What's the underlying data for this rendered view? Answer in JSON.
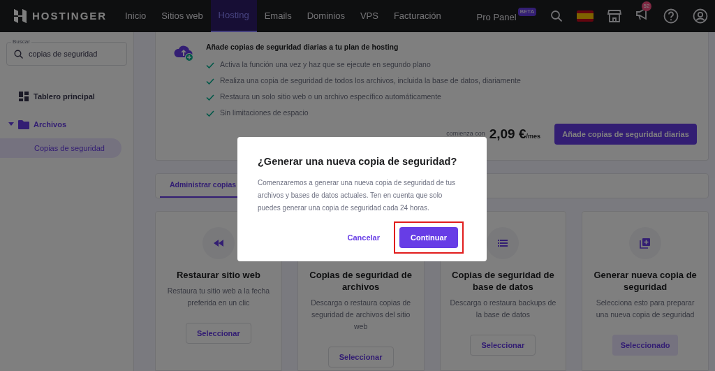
{
  "topbar": {
    "logo": "HOSTINGER",
    "nav": [
      {
        "label": "Inicio",
        "selected": false
      },
      {
        "label": "Sitios web",
        "selected": false
      },
      {
        "label": "Hosting",
        "selected": true
      },
      {
        "label": "Emails",
        "selected": false
      },
      {
        "label": "Dominios",
        "selected": false
      },
      {
        "label": "VPS",
        "selected": false
      },
      {
        "label": "Facturación",
        "selected": false
      }
    ],
    "pro_panel": "Pro Panel",
    "beta_badge": "BETA",
    "notification_count": "52"
  },
  "sidebar": {
    "search": {
      "label": "Buscar",
      "value": "copias de seguridad"
    },
    "items": [
      {
        "label": "Tablero principal",
        "kind": "dashboard",
        "selected": false
      },
      {
        "label": "Archivos",
        "kind": "folder",
        "expanded": true,
        "selected": false,
        "children": [
          {
            "label": "Copias de seguridad",
            "selected": true
          }
        ]
      }
    ]
  },
  "upsell": {
    "title": "Añade copias de seguridad diarias a tu plan de hosting",
    "features": [
      "Activa la función una vez y haz que se ejecute en segundo plano",
      "Realiza una copia de seguridad de todos los archivos, incluida la base de datos, diariamente",
      "Restaura un solo sitio web o un archivo específico automáticamente",
      "Sin limitaciones de espacio"
    ],
    "price_prefix": "comienza con",
    "price": "2,09 €",
    "price_suffix": "/mes",
    "button": "Añade copias de seguridad diarias"
  },
  "tabs": [
    {
      "label": "Administrar copias",
      "selected": true
    }
  ],
  "cards": [
    {
      "kind": "restore",
      "title": "Restaurar sitio web",
      "description": "Restaura tu sitio web a la fecha preferida en un clic",
      "button": "Seleccionar",
      "selected": false
    },
    {
      "kind": "files",
      "title": "Copias de seguridad de archivos",
      "description": "Descarga o restaura copias de seguridad de archivos del sitio web",
      "button": "Seleccionar",
      "selected": false
    },
    {
      "kind": "database",
      "title": "Copias de seguridad de base de datos",
      "description": "Descarga o restaura backups de la base de datos",
      "button": "Seleccionar",
      "selected": false
    },
    {
      "kind": "generate",
      "title": "Generar nueva copia de seguridad",
      "description": "Selecciona esto para preparar una nueva copia de seguridad",
      "button": "Seleccionado",
      "selected": true
    }
  ],
  "dialog": {
    "title": "¿Generar una nueva copia de seguridad?",
    "message": "Comenzaremos a generar una nueva copia de seguridad de tus archivos y bases de datos actuales. Ten en cuenta que solo puedes generar una copia de seguridad cada 24 horas.",
    "cancel": "Cancelar",
    "confirm": "Continuar",
    "confirm_highlighted": true
  }
}
